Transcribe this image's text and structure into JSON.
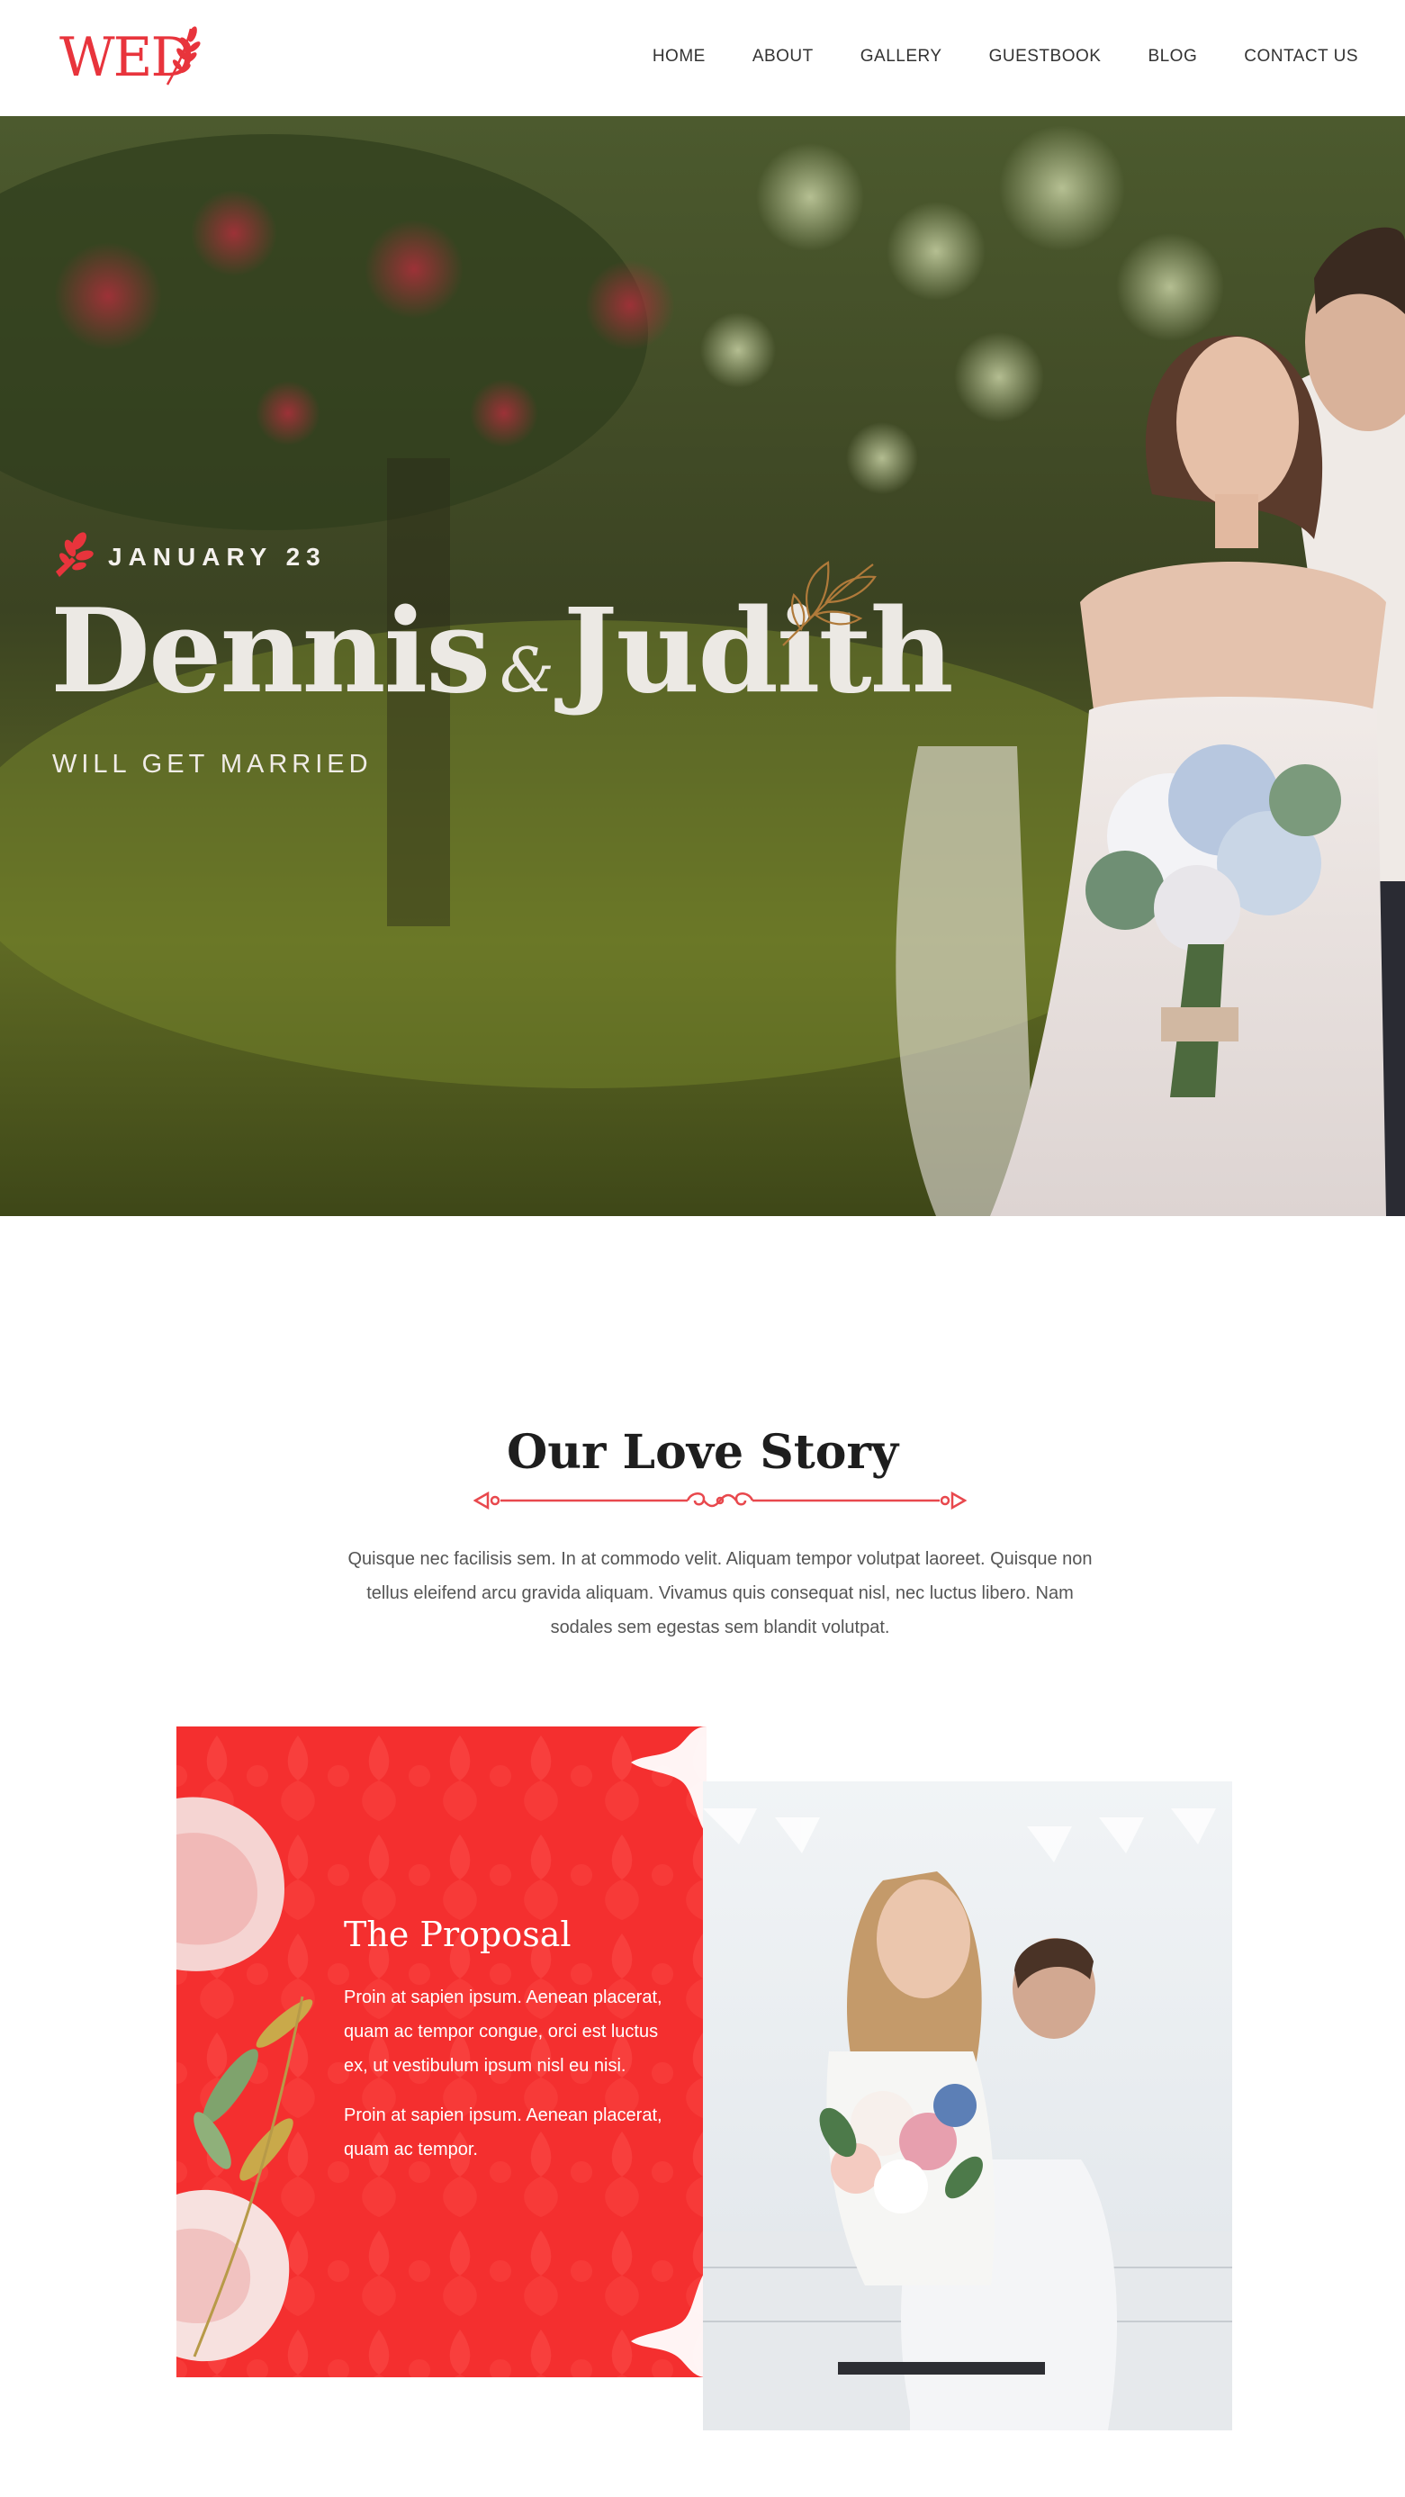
{
  "header": {
    "logo_text": "WED",
    "nav": [
      "HOME",
      "ABOUT",
      "GALLERY",
      "GUESTBOOK",
      "BLOG",
      "CONTACT US"
    ]
  },
  "hero": {
    "date": "JANUARY 23",
    "name1": "Dennis",
    "amp": "&",
    "name2": "Judith",
    "subtitle": "WILL GET MARRIED"
  },
  "story": {
    "title": "Our Love Story",
    "text": "Quisque nec facilisis sem. In at commodo velit. Aliquam tempor volutpat laoreet. Quisque non tellus eleifend arcu gravida aliquam. Vivamus quis consequat nisl, nec luctus libero. Nam sodales sem egestas sem blandit volutpat."
  },
  "proposal": {
    "title": "The Proposal",
    "p1": "Proin at sapien ipsum. Aenean placerat, quam ac tempor congue, orci est luctus ex, ut vestibulum ipsum nisl eu nisi.",
    "p2": "Proin at sapien ipsum. Aenean placerat, quam ac tempor."
  },
  "colors": {
    "accent": "#e8343c",
    "card_red": "#f42f2f"
  }
}
